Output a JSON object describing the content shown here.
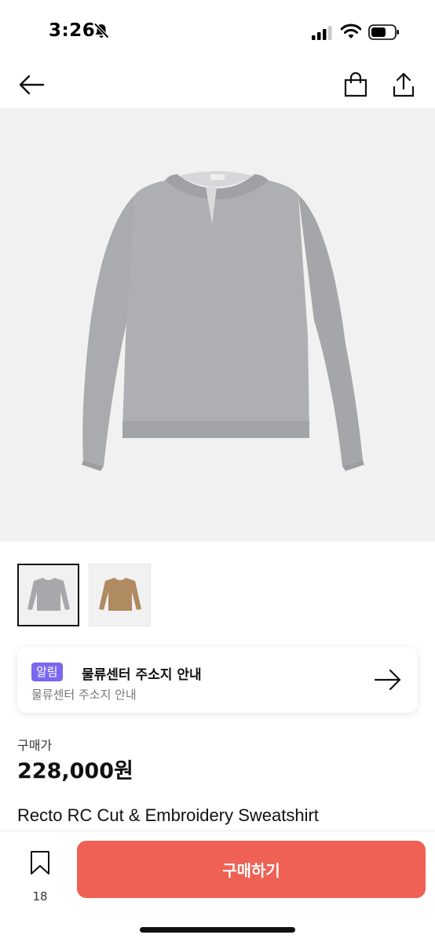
{
  "status_bar": {
    "time": "3:26",
    "icons": [
      "bell-slash-icon",
      "cellular-signal-icon",
      "wifi-icon",
      "battery-icon"
    ]
  },
  "nav": {
    "back_icon": "arrow-left-icon",
    "shop_icon": "shopping-bag-icon",
    "share_icon": "share-icon"
  },
  "product": {
    "image_subject": "grey-sweatshirt",
    "thumbnails": [
      {
        "color": "#a6a8ab",
        "selected": true
      },
      {
        "color": "#b08a61",
        "selected": false
      }
    ],
    "price_label": "구매가",
    "price": "228,000원",
    "name": "Recto RC Cut & Embroidery Sweatshirt"
  },
  "notice": {
    "badge": "알림",
    "title": "물류센터 주소지 안내",
    "subtitle": "물류센터 주소지 안내",
    "badge_color": "#7b67f0"
  },
  "bottom_bar": {
    "wishlist_count": "18",
    "buy_label": "구매하기",
    "buy_color": "#ef6154"
  }
}
